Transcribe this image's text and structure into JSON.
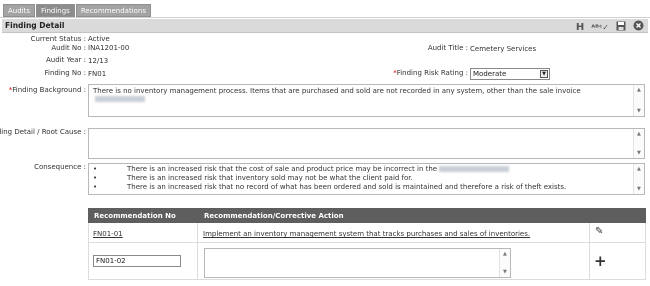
{
  "tabs": [
    {
      "label": "Audits"
    },
    {
      "label": "Findings"
    },
    {
      "label": "Recommendations"
    }
  ],
  "header": {
    "title": "Finding Detail",
    "icons": [
      "h-icon",
      "spellcheck-icon",
      "save-icon",
      "close-circle-icon"
    ]
  },
  "fields": {
    "current_status": {
      "label": "Current Status :",
      "value": "Active"
    },
    "audit_no": {
      "label": "Audit No :",
      "value": "INA1201-00"
    },
    "audit_year": {
      "label": "Audit Year :",
      "value": "12/13"
    },
    "finding_no": {
      "label": "Finding No :",
      "value": "FN01"
    },
    "audit_title": {
      "label": "Audit Title :",
      "value": "Cemetery Services"
    },
    "finding_risk_rating": {
      "label": "Finding Risk Rating :",
      "value": "Moderate"
    }
  },
  "finding_background": {
    "label": "Finding Background :",
    "text": "There is no inventory management process. Items that are purchased and sold are not recorded in any system, other than the sale invoice"
  },
  "finding_detail": {
    "label": "Finding Detail / Root Cause :",
    "text": ""
  },
  "consequence": {
    "label": "Consequence :",
    "items": [
      "There is an increased risk that the cost of sale and product price may be incorrect in the",
      "There is an increased risk that inventory sold may not be what the client paid for.",
      "There is an increased risk that no record of what has been ordered and sold is maintained and therefore a risk of theft exists."
    ]
  },
  "recommendations_table": {
    "headers": [
      "Recommendation No",
      "Recommendation/Corrective Action"
    ],
    "rows": [
      {
        "no": "FN01-01",
        "action": "Implement an inventory management system that tracks purchases and sales of inventories."
      }
    ],
    "new_row": {
      "no_value": "FN01-02",
      "action_value": ""
    }
  },
  "colors": {
    "tab_bg": "#a3a3a3",
    "header_bar": "#dadada",
    "table_header": "#5e5e5e",
    "required": "#d40000"
  }
}
